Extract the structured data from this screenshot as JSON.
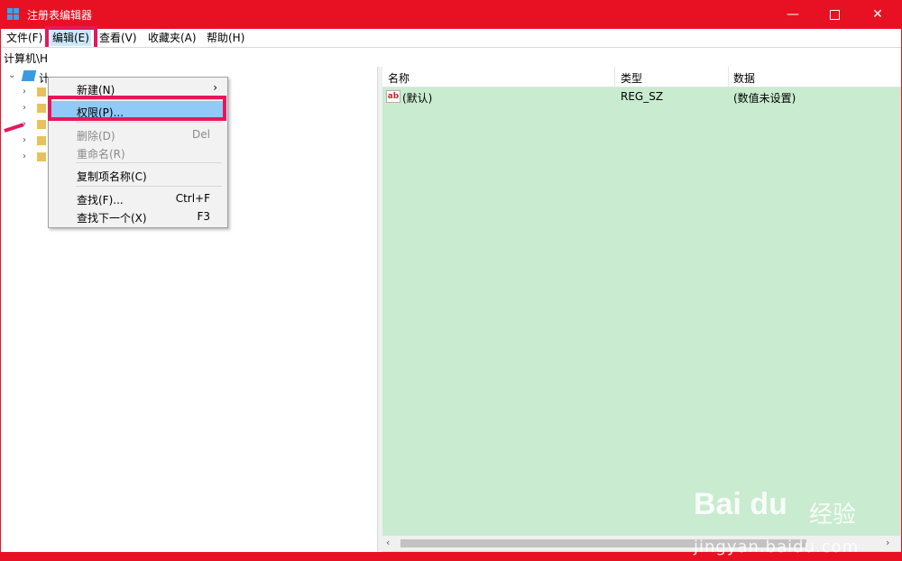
{
  "window": {
    "title": "注册表编辑器"
  },
  "title_buttons": {
    "minimize": "—",
    "close": "✕"
  },
  "menubar": {
    "items": [
      "文件(F)",
      "编辑(E)",
      "查看(V)",
      "收藏夹(A)",
      "帮助(H)"
    ]
  },
  "address": {
    "path": "计算机\\H"
  },
  "tree": {
    "root_label": "计",
    "chevron_expanded": "⌄",
    "chevron_collapsed": "›"
  },
  "list": {
    "columns": [
      "名称",
      "类型",
      "数据"
    ],
    "rows": [
      {
        "icon": "ab",
        "name": "(默认)",
        "type": "REG_SZ",
        "data": "(数值未设置)"
      }
    ]
  },
  "scrollbar": {
    "left": "‹",
    "right": "›"
  },
  "edit_menu": {
    "new": {
      "label": "新建(N)",
      "arrow": "›"
    },
    "permissions": {
      "label": "权限(P)..."
    },
    "delete": {
      "label": "删除(D)",
      "shortcut": "Del"
    },
    "rename": {
      "label": "重命名(R)"
    },
    "copy_key_name": {
      "label": "复制项名称(C)"
    },
    "find": {
      "label": "查找(F)...",
      "shortcut": "Ctrl+F"
    },
    "find_next": {
      "label": "查找下一个(X)",
      "shortcut": "F3"
    }
  },
  "watermark": {
    "brand": "Bai du",
    "jingyan": "经验",
    "url": "jingyan.baidu.com"
  },
  "colors": {
    "titlebar": "#e81123",
    "highlight_box": "#e5175d",
    "list_bg": "#c9ebd0",
    "menu_selected": "#91c9f7"
  }
}
